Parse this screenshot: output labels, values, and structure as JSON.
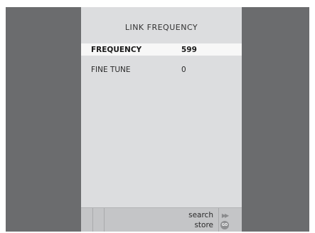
{
  "menu": {
    "title": "LINK FREQUENCY",
    "rows": [
      {
        "label": "FREQUENCY",
        "value": "599"
      },
      {
        "label": "FINE TUNE",
        "value": "0"
      }
    ]
  },
  "footer": {
    "search_label": "search",
    "store_label": "store",
    "search_key_icon": "fast-forward-icon",
    "store_key_icon": "go-button-icon",
    "go_text": "GO"
  },
  "colors": {
    "background": "#6b6c6e",
    "panel": "#dcdddf",
    "highlight": "#f7f7f7",
    "footer": "#c4c5c7"
  }
}
